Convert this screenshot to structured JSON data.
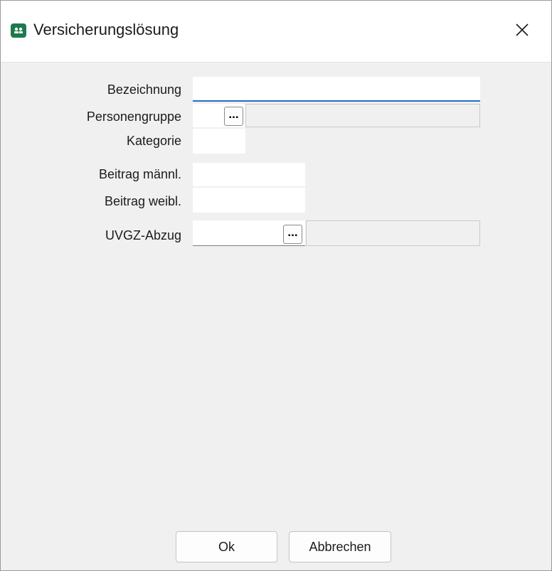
{
  "window": {
    "title": "Versicherungslösung"
  },
  "form": {
    "bezeichnung": {
      "label": "Bezeichnung",
      "value": ""
    },
    "personengruppe": {
      "label": "Personengruppe",
      "value": "",
      "description": "",
      "browse_label": "..."
    },
    "kategorie": {
      "label": "Kategorie",
      "value": ""
    },
    "beitrag_maennl": {
      "label": "Beitrag männl.",
      "value": ""
    },
    "beitrag_weibl": {
      "label": "Beitrag weibl.",
      "value": ""
    },
    "uvgz_abzug": {
      "label": "UVGZ-Abzug",
      "value": "",
      "description": "",
      "browse_label": "..."
    }
  },
  "buttons": {
    "ok": "Ok",
    "cancel": "Abbrechen"
  },
  "icons": {
    "app": "people-group-icon",
    "close": "close-icon"
  },
  "colors": {
    "app_icon": "#1e7a4e",
    "focus_underline": "#1f6fc4"
  }
}
